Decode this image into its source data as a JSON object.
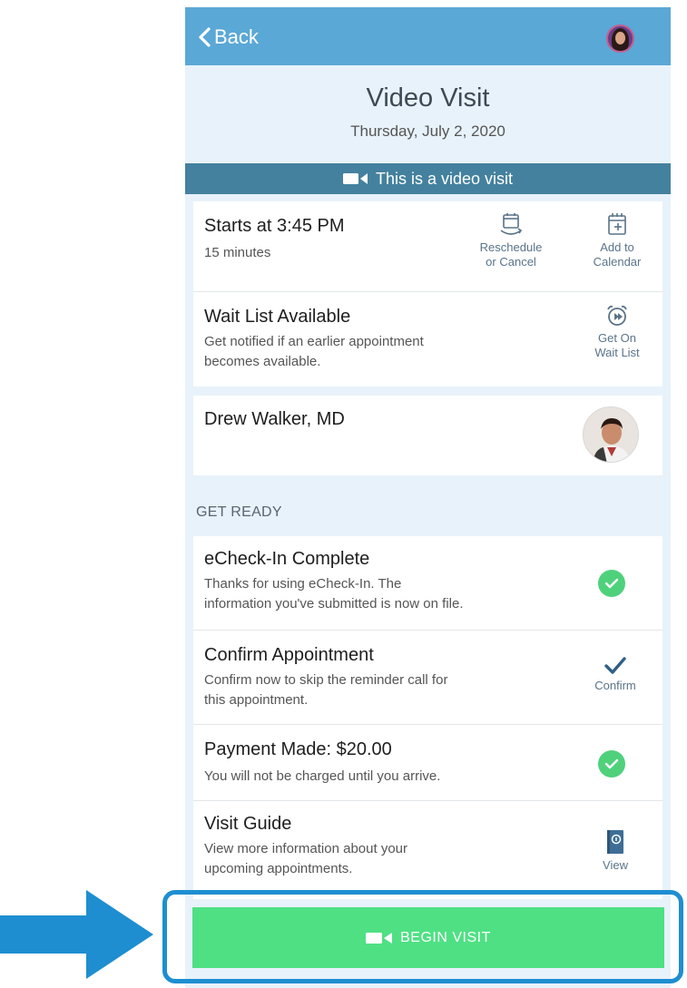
{
  "nav": {
    "back_label": "Back"
  },
  "header": {
    "title": "Video Visit",
    "date": "Thursday, July 2, 2020"
  },
  "banner": {
    "text": "This is a video visit"
  },
  "appointment": {
    "starts": "Starts at 3:45 PM",
    "duration": "15 minutes",
    "reschedule_line1": "Reschedule",
    "reschedule_line2": "or Cancel",
    "calendar_line1": "Add to",
    "calendar_line2": "Calendar"
  },
  "waitlist": {
    "title": "Wait List Available",
    "desc_line1": "Get notified if an earlier appointment",
    "desc_line2": "becomes available.",
    "action_line1": "Get On",
    "action_line2": "Wait List"
  },
  "provider": {
    "name": "Drew Walker, MD"
  },
  "get_ready": {
    "label": "GET READY",
    "items": [
      {
        "title": "eCheck-In Complete",
        "desc_line1": "Thanks for using eCheck-In. The",
        "desc_line2": "information you've submitted is now on file.",
        "status": "complete"
      },
      {
        "title": "Confirm Appointment",
        "desc_line1": "Confirm now to skip the reminder call for",
        "desc_line2": "this appointment.",
        "action": "Confirm"
      },
      {
        "title": "Payment Made: $20.00",
        "desc_line1": "You will not be charged until you arrive.",
        "status": "complete"
      },
      {
        "title": "Visit Guide",
        "desc_line1": "View more information about your",
        "desc_line2": "upcoming appointments.",
        "action": "View"
      }
    ]
  },
  "begin": {
    "label": "BEGIN VISIT"
  },
  "colors": {
    "topbar": "#5aa8d6",
    "banner": "#44819e",
    "begin_button": "#4fe084",
    "check_green": "#4fd17c",
    "highlight": "#1e8ed1"
  }
}
